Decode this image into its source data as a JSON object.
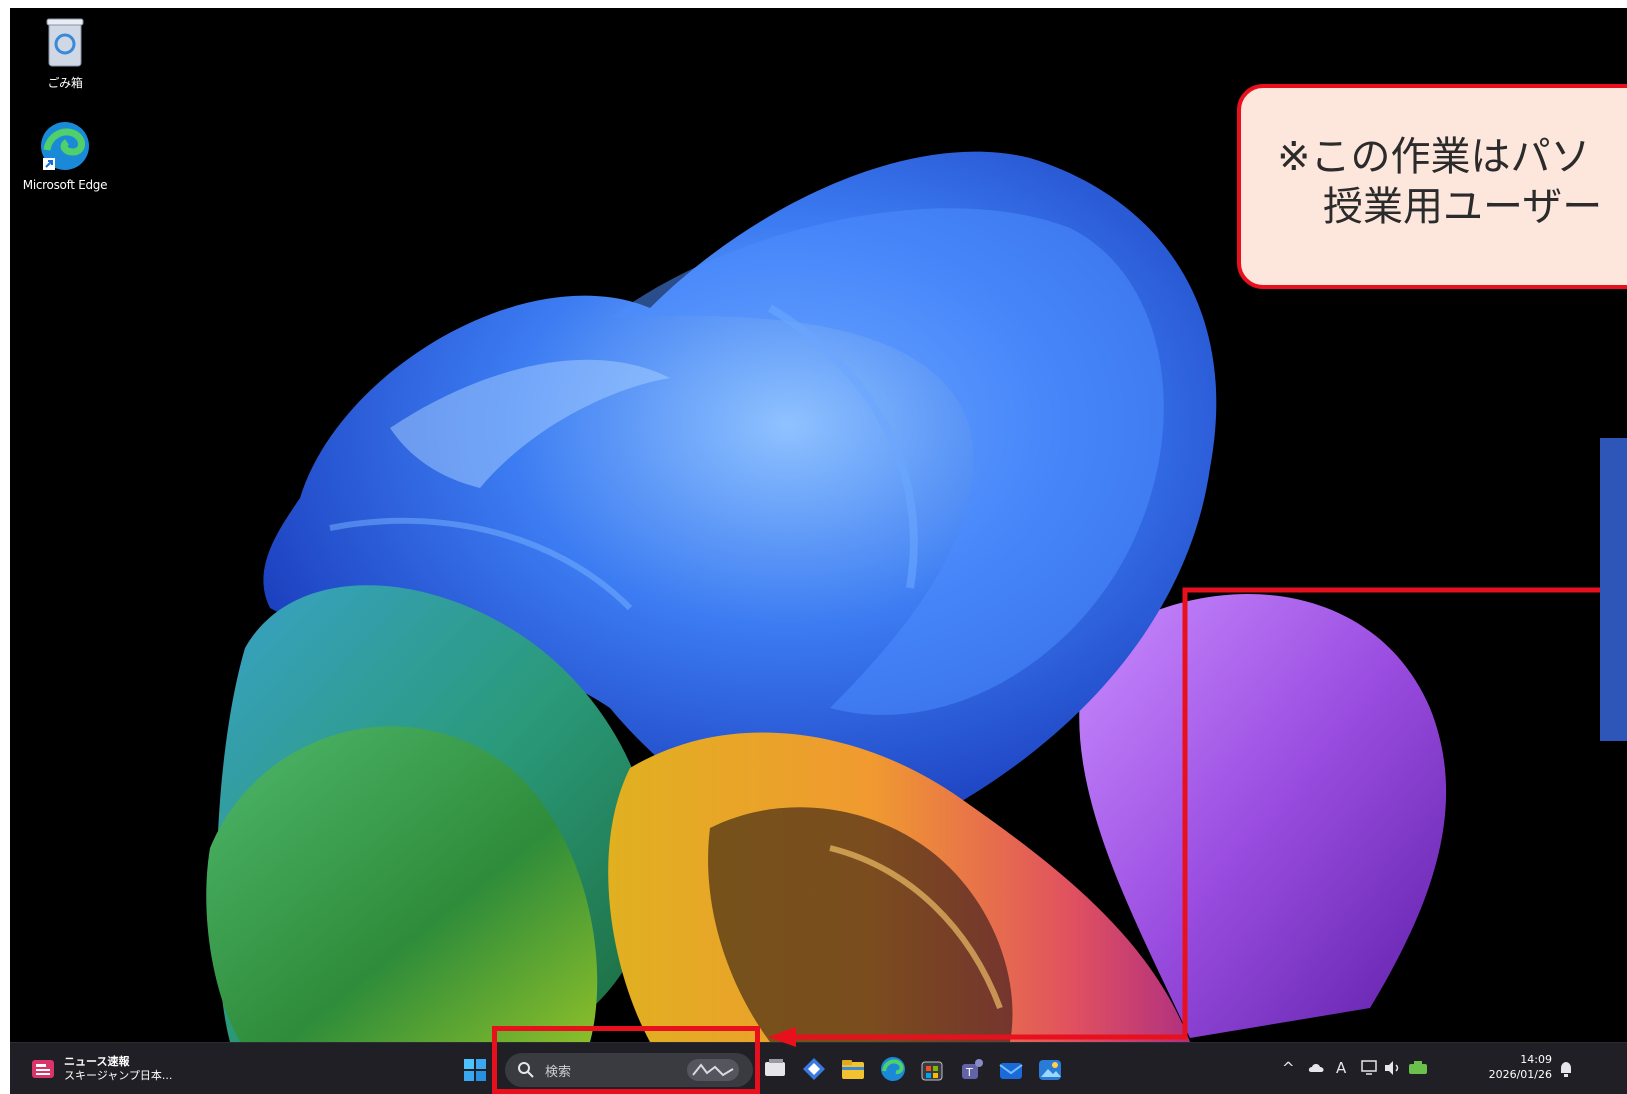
{
  "desktop": {
    "icons": [
      {
        "label": "ごみ箱",
        "icon": "recycle-bin-icon"
      },
      {
        "label": "Microsoft Edge",
        "icon": "edge-icon"
      }
    ]
  },
  "taskbar": {
    "news": {
      "title": "ニュース速報",
      "subtitle": "スキージャンプ日本..."
    },
    "search": {
      "placeholder": "検索"
    },
    "apps": [
      "task-view-icon",
      "copilot-icon",
      "file-explorer-icon",
      "edge-icon",
      "microsoft-store-icon",
      "teams-icon",
      "outlook-icon",
      "photos-icon"
    ],
    "tray": {
      "ime": "A",
      "time": "14:09",
      "date": "2026/01/26"
    }
  },
  "note": {
    "line1": "※この作業はパソ",
    "line2": "授業用ユーザー"
  },
  "colors": {
    "highlight": "#e8101c",
    "note_bg": "#fde7dd",
    "panel": "#2e56b8",
    "taskbar": "#1f1f25"
  }
}
